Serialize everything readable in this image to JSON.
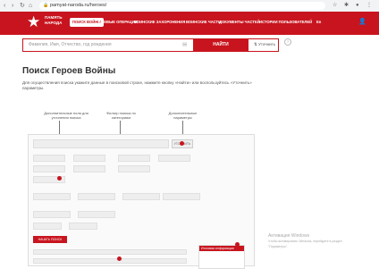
{
  "browser": {
    "url": "pamyat-naroda.ru/heroes/"
  },
  "header": {
    "logo_line1": "ПАМЯТЬ",
    "logo_line2": "НАРОДА",
    "nav": [
      {
        "label": "ПОИСК ВОЙНЫ",
        "active": true
      },
      {
        "label": "БОЕВЫЕ ОПЕРАЦИИ",
        "active": false
      },
      {
        "label": "ВОИНСКИЕ ЗАХОРОНЕНИЯ",
        "active": false
      },
      {
        "label": "ВОИНСКИЕ ЧАСТИ",
        "active": false
      },
      {
        "label": "ДОКУМЕНТЫ ЧАСТЕЙ",
        "active": false
      },
      {
        "label": "ИСТОРИИ ПОЛЬЗОВАТЕЛЕЙ",
        "active": false
      },
      {
        "label": "En",
        "active": false
      }
    ]
  },
  "search": {
    "placeholder": "Фамилия, Имя, Отчество, год рождения",
    "find_button": "НАЙТИ",
    "refine_label": "Уточнить"
  },
  "page": {
    "title": "Поиск Героев Войны",
    "description": "Для осуществления поиска укажите данные в поисковой строке, нажмите кнопку «Найти» или воспользуйтесь «Уточнить» параметры."
  },
  "annotations": {
    "a1": "Дополнительные поля для уточнения поиска",
    "a2": "Фильтр поиска по категориям",
    "a3": "Дополнительные параметры",
    "a4": "Итоговые информация"
  },
  "tutorial": {
    "search_btn": "УТОЧНИТЬ",
    "red_btn": "НАЧАТЬ ПОИСК",
    "panel_header": "Итоговая информация"
  },
  "windows": {
    "line1": "Активация Windows",
    "line2": "Чтобы активировать Windows, перейдите в раздел \"Параметры\"."
  }
}
